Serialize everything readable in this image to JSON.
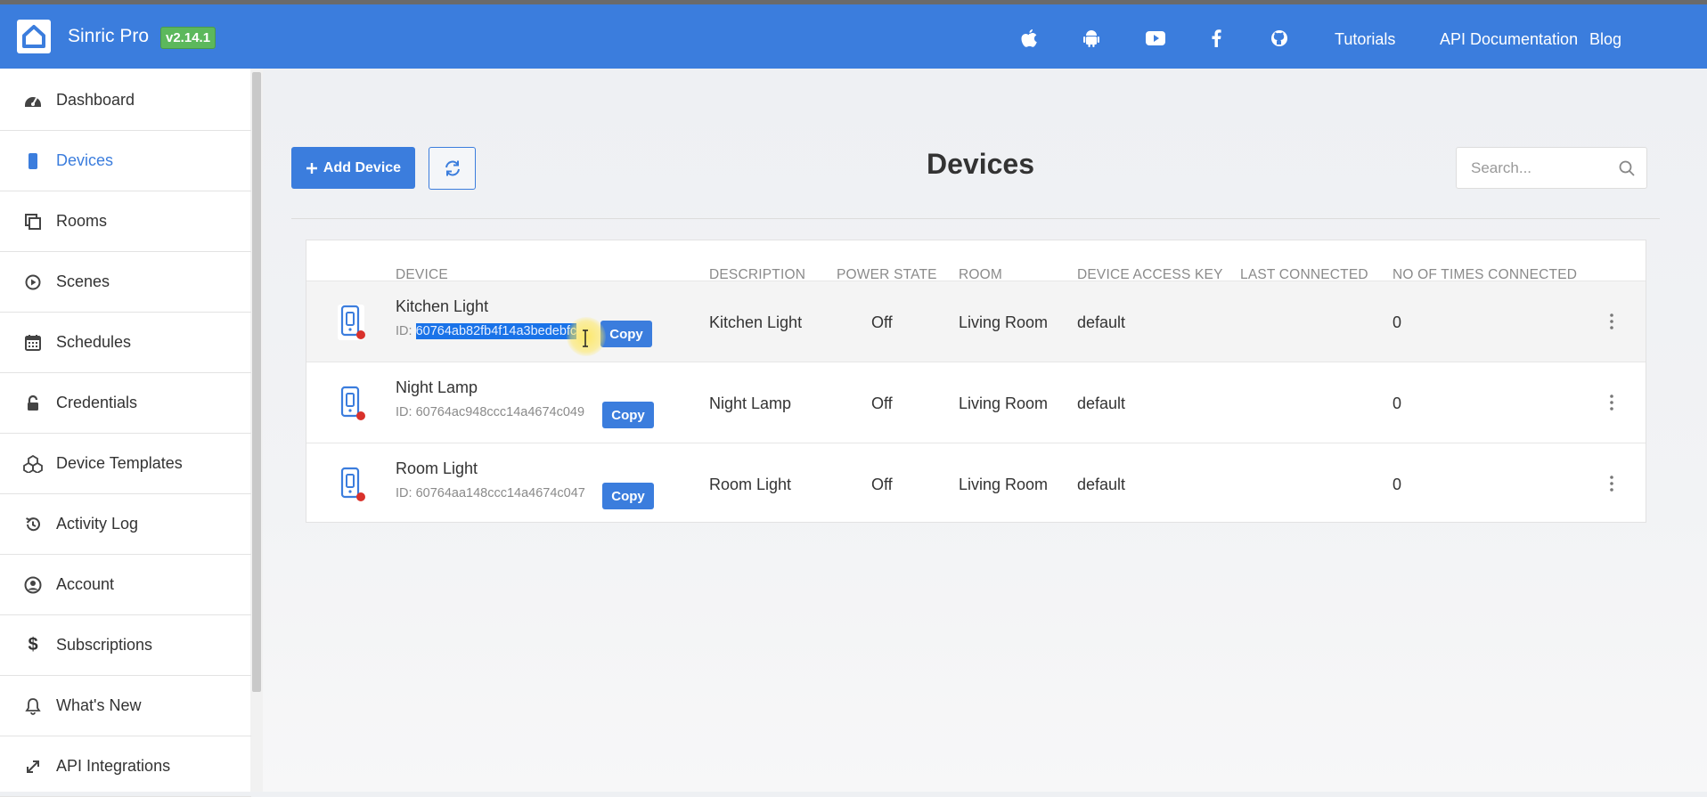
{
  "header": {
    "brand": "Sinric Pro",
    "version": "v2.14.1",
    "icons": [
      "apple-icon",
      "android-icon",
      "youtube-icon",
      "facebook-icon",
      "github-icon"
    ],
    "links": [
      "Tutorials",
      "API Documentation",
      "Blog"
    ]
  },
  "sidebar": {
    "items": [
      {
        "label": "Dashboard",
        "icon": "dashboard-icon"
      },
      {
        "label": "Devices",
        "icon": "device-icon",
        "active": true
      },
      {
        "label": "Rooms",
        "icon": "rooms-icon"
      },
      {
        "label": "Scenes",
        "icon": "play-circle-icon"
      },
      {
        "label": "Schedules",
        "icon": "calendar-icon"
      },
      {
        "label": "Credentials",
        "icon": "lock-icon"
      },
      {
        "label": "Device Templates",
        "icon": "cubes-icon"
      },
      {
        "label": "Activity Log",
        "icon": "history-icon"
      },
      {
        "label": "Account",
        "icon": "user-circle-icon"
      },
      {
        "label": "Subscriptions",
        "icon": "dollar-icon"
      },
      {
        "label": "What's New",
        "icon": "bell-icon"
      },
      {
        "label": "API Integrations",
        "icon": "expand-arrows-icon"
      }
    ]
  },
  "toolbar": {
    "add_device_label": "Add Device",
    "refresh_icon": "refresh-icon",
    "page_title": "Devices",
    "search_placeholder": "Search..."
  },
  "table": {
    "headers": [
      "DEVICE",
      "DESCRIPTION",
      "POWER STATE",
      "ROOM",
      "DEVICE ACCESS KEY",
      "LAST CONNECTED",
      "NO OF TIMES CONNECTED"
    ],
    "rows": [
      {
        "name": "Kitchen Light",
        "id_prefix": "ID: ",
        "id": "60764ab82fb4f14a3bedebfc",
        "id_visible": "60764ab82fb4f14a3bedebfc",
        "copy_label": "Copy",
        "description": "Kitchen Light",
        "power_state": "Off",
        "room": "Living Room",
        "access_key": "default",
        "last_connected": "",
        "times_connected": "0",
        "selected": true
      },
      {
        "name": "Night Lamp",
        "id_prefix": "ID: ",
        "id": "60764ac948ccc14a4674c049",
        "copy_label": "Copy",
        "description": "Night Lamp",
        "power_state": "Off",
        "room": "Living Room",
        "access_key": "default",
        "last_connected": "",
        "times_connected": "0"
      },
      {
        "name": "Room Light",
        "id_prefix": "ID: ",
        "id": "60764aa148ccc14a4674c047",
        "copy_label": "Copy",
        "description": "Room Light",
        "power_state": "Off",
        "room": "Living Room",
        "access_key": "default",
        "last_connected": "",
        "times_connected": "0"
      }
    ]
  },
  "colors": {
    "primary": "#3b7ddd",
    "version_badge": "#5cb85c",
    "status_offline": "#d9312b",
    "selection": "#1a73e8"
  }
}
